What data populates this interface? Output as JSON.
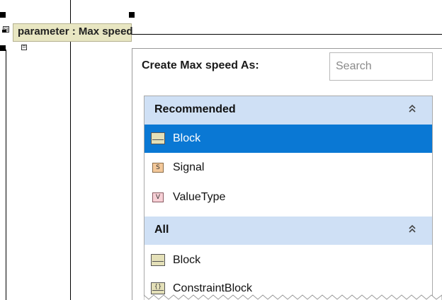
{
  "diagram": {
    "part_label": "parameter : Max speed",
    "collapse_glyph": "⊟",
    "port_glyph": "⊡"
  },
  "popup": {
    "title": "Create Max speed As:",
    "search": {
      "value": "",
      "placeholder": "Search"
    },
    "groups": [
      {
        "label": "Recommended",
        "collapse_icon": "⌃⌃",
        "items": [
          {
            "label": "Block",
            "icon": "block-icon",
            "selected": true
          },
          {
            "label": "Signal",
            "icon": "signal-icon",
            "icon_glyph": "S"
          },
          {
            "label": "ValueType",
            "icon": "valuetype-icon",
            "icon_glyph": "V"
          }
        ]
      },
      {
        "label": "All",
        "collapse_icon": "⌃⌃",
        "items": [
          {
            "label": "Block",
            "icon": "block-icon"
          },
          {
            "label": "ConstraintBlock",
            "icon": "constraint-block-icon",
            "icon_glyph": "{}"
          }
        ]
      }
    ]
  },
  "colors": {
    "selection": "#0a78d4",
    "group_header": "#cfe0f5",
    "part_fill": "#e8e6c2"
  }
}
